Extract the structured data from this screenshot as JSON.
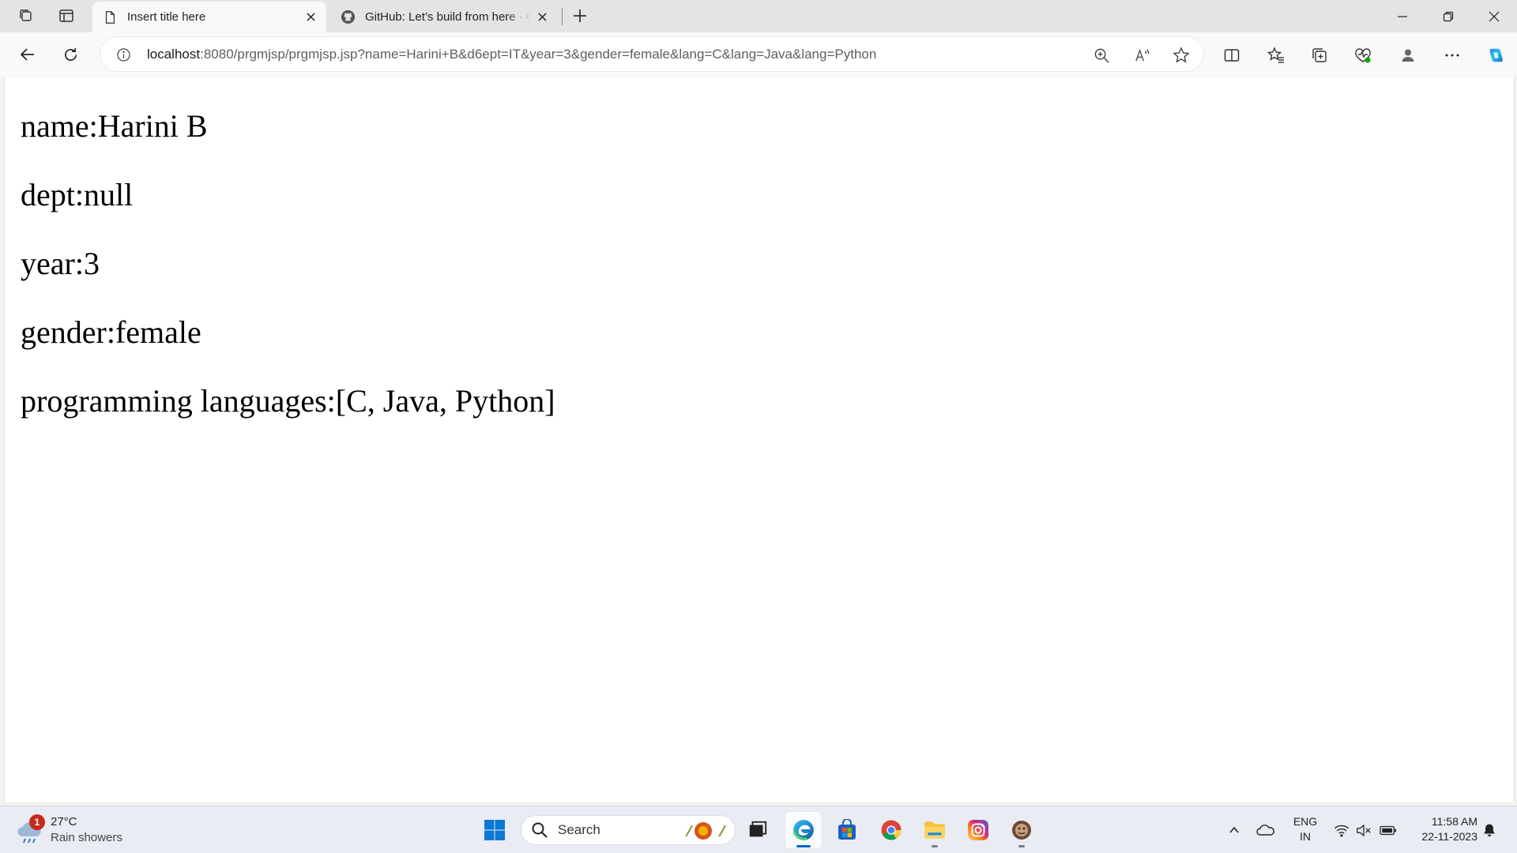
{
  "browser": {
    "tabs": [
      {
        "title": "Insert title here",
        "active": true
      },
      {
        "title": "GitHub: Let’s build from here · GitHub",
        "active": false
      }
    ],
    "address": {
      "host": "localhost",
      "rest": ":8080/prgmjsp/prgmjsp.jsp?name=Harini+B&d6ept=IT&year=3&gender=female&lang=C&lang=Java&lang=Python"
    },
    "icons": [
      "tab-actions-icon",
      "vertical-tabs-icon",
      "page-icon",
      "github-icon",
      "close-icon",
      "new-tab-icon",
      "minimize-icon",
      "restore-icon",
      "close-window-icon",
      "back-icon",
      "refresh-icon",
      "info-icon",
      "zoom-icon",
      "read-aloud-icon",
      "favorite-star-icon",
      "split-screen-icon",
      "favorites-icon",
      "collections-icon",
      "browser-essentials-icon",
      "profile-icon",
      "more-icon",
      "copilot-icon"
    ]
  },
  "page": {
    "lines": [
      "name:Harini B",
      "dept:null",
      "year:3",
      "gender:female",
      "programming languages:[C, Java, Python]"
    ]
  },
  "taskbar": {
    "weather": {
      "badge": "1",
      "temp": "27°C",
      "condition": "Rain showers"
    },
    "search_label": "Search",
    "language": {
      "line1": "ENG",
      "line2": "IN"
    },
    "clock": {
      "time": "11:58 AM",
      "date": "22-11-2023"
    },
    "apps": [
      "start-icon",
      "task-view-icon",
      "edge-icon",
      "store-icon",
      "chrome-icon",
      "file-explorer-icon",
      "instagram-icon",
      "app-icon"
    ]
  }
}
